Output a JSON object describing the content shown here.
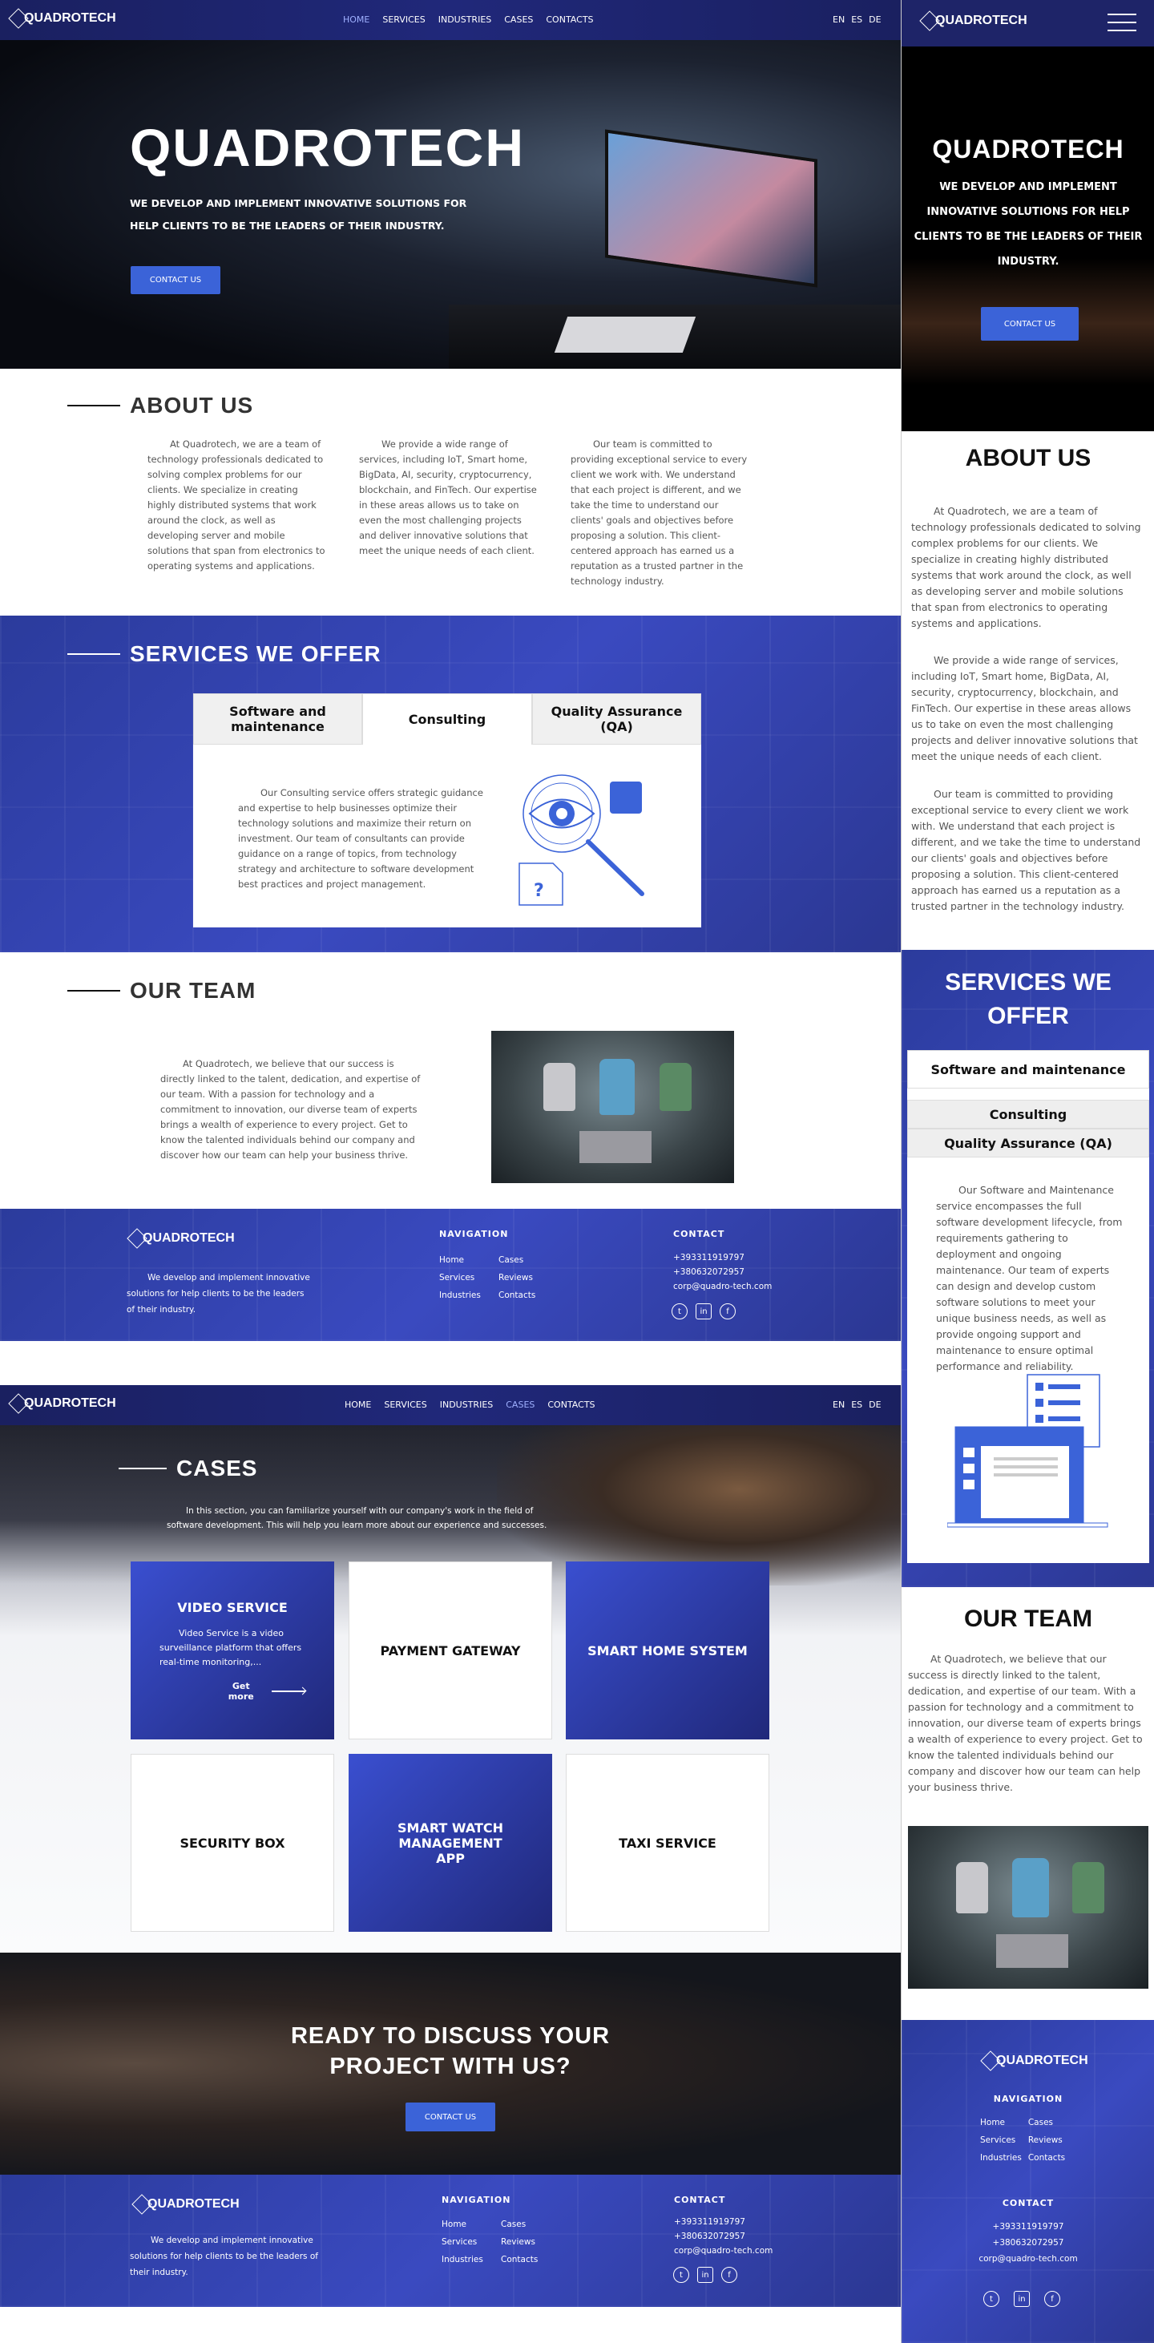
{
  "brand": {
    "logo_text": "QUADROTECH"
  },
  "nav": {
    "links_upper": [
      "HOME",
      "SERVICES",
      "INDUSTRIES",
      "CASES",
      "CONTACTS"
    ],
    "langs": [
      "EN",
      "ES",
      "DE"
    ]
  },
  "hero": {
    "title": "QUADROTECH",
    "subtitle": "WE DEVELOP AND IMPLEMENT INNOVATIVE SOLUTIONS FOR HELP CLIENTS TO BE THE LEADERS OF THEIR INDUSTRY.",
    "cta": "CONTACT US"
  },
  "about": {
    "title": "ABOUT US",
    "p1": "At Quadrotech, we are a team of technology professionals dedicated to solving complex problems for our clients. We specialize in creating highly distributed systems that work around the clock, as well as developing server and mobile solutions that span from electronics to operating systems and applications.",
    "p2": "We provide a wide range of services, including IoT, Smart home, BigData, AI, security, cryptocurrency, blockchain, and FinTech. Our expertise in these areas allows us to take on even the most challenging projects and deliver innovative solutions that meet the unique needs of each client.",
    "p3": "Our team is committed to providing exceptional service to every client we work with. We understand that each project is different, and we take the time to understand our clients' goals and objectives before proposing a solution. This client-centered approach has earned us a reputation as a trusted partner in the technology industry."
  },
  "services": {
    "title": "SERVICES WE OFFER",
    "tabs": [
      "Software and maintenance",
      "Consulting",
      "Quality Assurance (QA)"
    ],
    "consulting_text": "Our Consulting service offers strategic guidance and expertise to help businesses optimize their technology solutions and maximize their return on investment. Our team of consultants can provide guidance on a range of topics, from technology strategy and architecture to software development best practices and project management.",
    "software_text": "Our Software and Maintenance service encompasses the full software development lifecycle, from requirements gathering to deployment and ongoing maintenance. Our team of experts can design and develop custom software solutions to meet your unique business needs, as well as provide ongoing support and maintenance to ensure optimal performance and reliability."
  },
  "team": {
    "title": "OUR TEAM",
    "text": "At Quadrotech, we believe that our success is directly linked to the talent, dedication, and expertise of our team. With a passion for technology and a commitment to innovation, our diverse team of experts brings a wealth of experience to every project. Get to know the talented individuals behind our company and discover how our team can help your business thrive."
  },
  "footer": {
    "tagline": "We develop and implement innovative solutions for help clients to be the leaders of their industry.",
    "nav_title": "NAVIGATION",
    "nav_col1": [
      "Home",
      "Services",
      "Industries"
    ],
    "nav_col2": [
      "Cases",
      "Reviews",
      "Contacts"
    ],
    "contact_title": "CONTACT",
    "phone1": "+393311919797",
    "phone2": "+380632072957",
    "email": "corp@quadro-tech.com"
  },
  "nav2": {
    "links": [
      "HOME",
      "SERVICES",
      "INDUSTRIES",
      "CASES",
      "CONTACTS"
    ]
  },
  "cases": {
    "title": "CASES",
    "intro": "In this section, you can familiarize yourself with our company's work in the field of software development. This will help you learn more about our experience and successes.",
    "items": [
      {
        "title": "VIDEO SERVICE",
        "desc": "Video Service is a video surveillance platform that offers real-time monitoring,...",
        "more": "Get more"
      },
      {
        "title": "PAYMENT GATEWAY"
      },
      {
        "title": "SMART HOME SYSTEM"
      },
      {
        "title": "SECURITY BOX"
      },
      {
        "title": "SMART WATCH MANAGEMENT APP"
      },
      {
        "title": "TAXI SERVICE"
      }
    ]
  },
  "cta": {
    "title": "READY TO DISCUSS YOUR PROJECT WITH US?",
    "button": "CONTACT US"
  },
  "colors": {
    "accent": "#3b63d8",
    "brand_blue": "#2b3b9c",
    "nav_dark": "#1a2060"
  }
}
